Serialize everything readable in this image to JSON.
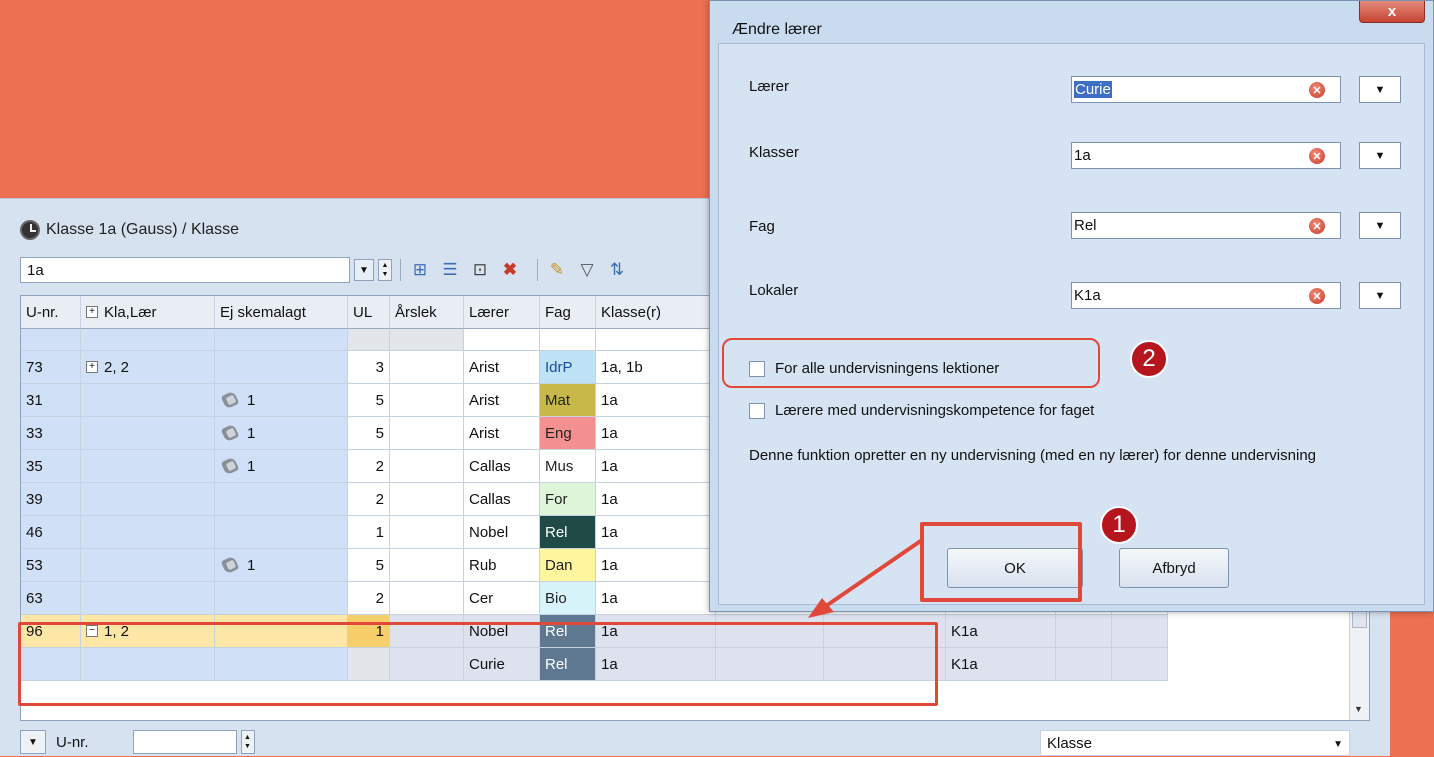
{
  "main": {
    "title": "Klasse 1a (Gauss) / Klasse",
    "class_combo": "1a",
    "columns": [
      "U-nr.",
      "Kla,Lær",
      "Ej skemalagt",
      "UL",
      "Årslek",
      "Lærer",
      "Fag",
      "Klasse(r)"
    ],
    "rows": [
      {
        "unr": "73",
        "kla": "2, 2",
        "ej": "",
        "ul": "3",
        "laerer": "Arist",
        "fag": "IdrP",
        "fag_color": "#bfe3f6",
        "fag_text": "#1a4fa0",
        "klasse": "1a, 1b"
      },
      {
        "unr": "31",
        "kla": "",
        "ej": "1",
        "ul": "5",
        "laerer": "Arist",
        "fag": "Mat",
        "fag_color": "#c6b94a",
        "fag_text": "#222",
        "klasse": "1a"
      },
      {
        "unr": "33",
        "kla": "",
        "ej": "1",
        "ul": "5",
        "laerer": "Arist",
        "fag": "Eng",
        "fag_color": "#f59090",
        "fag_text": "#222",
        "klasse": "1a"
      },
      {
        "unr": "35",
        "kla": "",
        "ej": "1",
        "ul": "2",
        "laerer": "Callas",
        "fag": "Mus",
        "fag_color": "#ffffff",
        "fag_text": "#222",
        "klasse": "1a"
      },
      {
        "unr": "39",
        "kla": "",
        "ej": "",
        "ul": "2",
        "laerer": "Callas",
        "fag": "For",
        "fag_color": "#dff5d8",
        "fag_text": "#222",
        "klasse": "1a"
      },
      {
        "unr": "46",
        "kla": "",
        "ej": "",
        "ul": "1",
        "laerer": "Nobel",
        "fag": "Rel",
        "fag_color": "#1f4a45",
        "fag_text": "#ffffff",
        "klasse": "1a"
      },
      {
        "unr": "53",
        "kla": "",
        "ej": "1",
        "ul": "5",
        "laerer": "Rub",
        "fag": "Dan",
        "fag_color": "#fff59e",
        "fag_text": "#222",
        "klasse": "1a"
      },
      {
        "unr": "63",
        "kla": "",
        "ej": "",
        "ul": "2",
        "laerer": "Cer",
        "fag": "Bio",
        "fag_color": "#d8f4fb",
        "fag_text": "#222",
        "klasse": "1a"
      }
    ],
    "selected_rows": [
      {
        "unr": "96",
        "kla": "1, 2",
        "ul": "1",
        "laerer": "Nobel",
        "fag": "Rel",
        "klasse": "1a",
        "lokale": "K1a"
      },
      {
        "unr": "",
        "kla": "",
        "ul": "",
        "laerer": "Curie",
        "fag": "Rel",
        "klasse": "1a",
        "lokale": "K1a"
      }
    ],
    "bottom": {
      "unr_label": "U-nr.",
      "view_select": "Klasse"
    }
  },
  "dialog": {
    "title": "Ændre lærer",
    "close": "x",
    "fields": [
      {
        "label": "Lærer",
        "value": "Curie"
      },
      {
        "label": "Klasser",
        "value": "1a"
      },
      {
        "label": "Fag",
        "value": "Rel"
      },
      {
        "label": "Lokaler",
        "value": "K1a"
      }
    ],
    "check_all_lessons": "For alle undervisningens lektioner",
    "check_competence": "Lærere med undervisningskompetence for faget",
    "info": "Denne funktion opretter en ny undervisning (med en ny lærer) for denne undervisning",
    "ok": "OK",
    "cancel": "Afbryd"
  },
  "annotations": {
    "one": "1",
    "two": "2"
  }
}
